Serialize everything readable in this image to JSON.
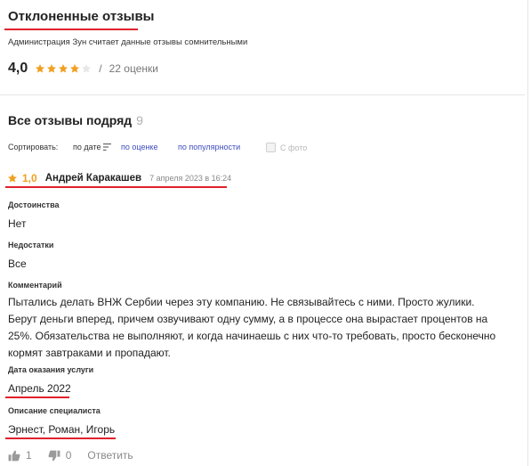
{
  "header": {
    "title": "Отклоненные отзывы",
    "subtitle": "Администрация Зун считает данные отзывы сомнительными"
  },
  "summary": {
    "rating": "4,0",
    "stars_filled": 4,
    "stars_total": 5,
    "separator": "/",
    "count_text": "22 оценки"
  },
  "all_reviews": {
    "title": "Все отзывы подряд",
    "count": "9"
  },
  "sort": {
    "label": "Сортировать:",
    "by_date": "по дате",
    "by_rating": "по оценке",
    "by_popularity": "по популярности",
    "with_photo": "С фото"
  },
  "review": {
    "rating": "1,0",
    "author": "Андрей Каракашев",
    "date": "7 апреля 2023 в 16:24",
    "pros_label": "Достоинства",
    "pros": "Нет",
    "cons_label": "Недостатки",
    "cons": "Все",
    "comment_label": "Комментарий",
    "comment": "Пытались делать ВНЖ Сербии через эту компанию. Не связывайтесь с ними. Просто жулики. Берут деньги вперед, причем озвучивают одну сумму, а в процессе она вырастает процентов на 25%. Обязательства не выполняют, и когда начинаешь с них что-то требовать, просто бесконечно кормят завтраками и пропадают.",
    "service_date_label": "Дата оказания услуги",
    "service_date": "Апрель 2022",
    "specialist_label": "Описание специалиста",
    "specialist": "Эрнест, Роман, Игорь",
    "likes": "1",
    "dislikes": "0",
    "reply_label": "Ответить"
  },
  "colors": {
    "accent_red": "#e0212b",
    "star_gold": "#f0a020",
    "link_blue": "#3d4dbf"
  }
}
